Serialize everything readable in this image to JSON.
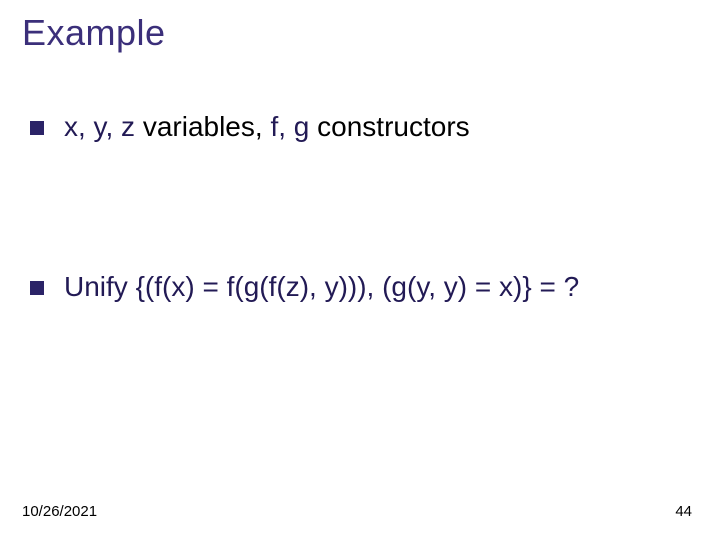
{
  "title": "Example",
  "bullets": [
    {
      "vars": "x, y, z",
      "plain1": " variables, ",
      "ctors": "f, g",
      "plain2": " constructors"
    },
    {
      "text": "Unify {(f(x) = f(g(f(z), y))), (g(y, y) = x)} = ?"
    }
  ],
  "footer": {
    "date": "10/26/2021",
    "page": "44"
  }
}
